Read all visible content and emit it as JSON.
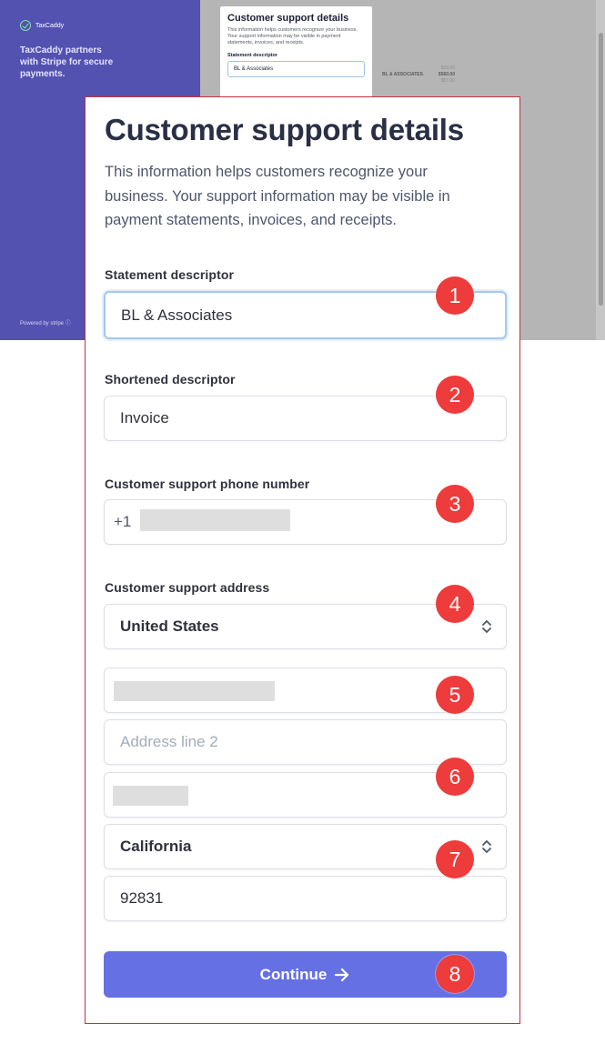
{
  "background": {
    "brand_name": "TaxCaddy",
    "tagline": "TaxCaddy partners with Stripe for secure payments.",
    "powered_by": "Powered by stripe ⓘ",
    "mini_card": {
      "title": "Customer support details",
      "description": "This information helps customers recognize your business. Your support information may be visible in payment statements, invoices, and receipts.",
      "label": "Statement descriptor",
      "value": "BL & Associates"
    },
    "receipt": {
      "line1_amount": "$29.00",
      "line2_label": "BL & ASSOCIATES",
      "line2_amount": "$560.00",
      "line3_amount": "$57.00"
    }
  },
  "form": {
    "title": "Customer support details",
    "description": "This information helps customers recognize your business. Your support information may be visible in payment statements, invoices, and receipts.",
    "statement_descriptor": {
      "label": "Statement descriptor",
      "value": "BL & Associates"
    },
    "shortened_descriptor": {
      "label": "Shortened descriptor",
      "value": "Invoice"
    },
    "phone": {
      "label": "Customer support phone number",
      "prefix": "+1"
    },
    "address": {
      "label": "Customer support address",
      "country": "United States",
      "line2_placeholder": "Address line 2",
      "state": "California",
      "zip": "92831"
    },
    "continue_label": "Continue",
    "continue_icon": "arrow-right-icon"
  },
  "annotations": [
    "1",
    "2",
    "3",
    "4",
    "5",
    "6",
    "7",
    "8"
  ],
  "colors": {
    "accent": "#6570e4",
    "badge": "#ee3b3b",
    "sidebar": "#5452b0",
    "modal_border": "#c4303c"
  }
}
